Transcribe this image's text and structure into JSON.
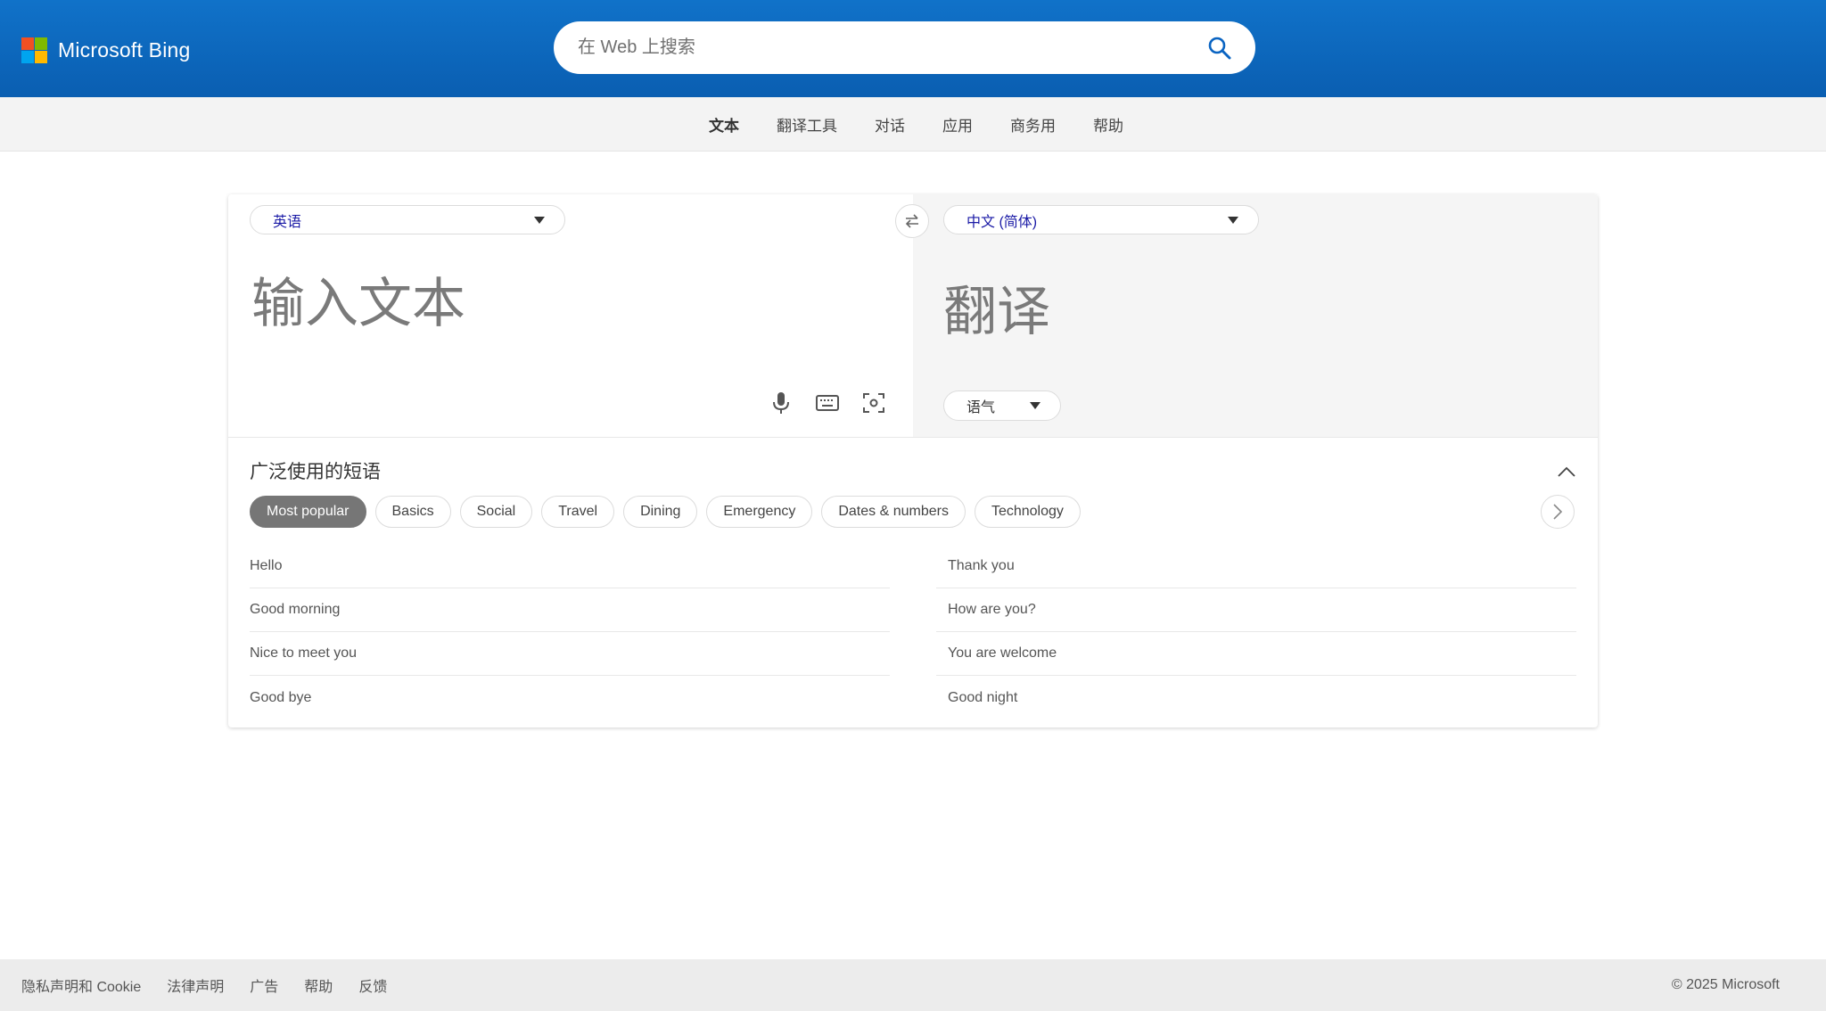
{
  "header": {
    "brand": "Microsoft Bing",
    "logo_colors": [
      "#f25022",
      "#7fba00",
      "#00a4ef",
      "#ffb900"
    ],
    "search_placeholder": "在 Web 上搜索"
  },
  "nav": {
    "items": [
      "文本",
      "翻译工具",
      "对话",
      "应用",
      "商务用",
      "帮助"
    ],
    "active_index": 0
  },
  "translator": {
    "source_lang": "英语",
    "target_lang": "中文 (简体)",
    "source_placeholder": "输入文本",
    "target_placeholder": "翻译",
    "tone_label": "语气"
  },
  "phrases": {
    "title": "广泛使用的短语",
    "categories": [
      "Most popular",
      "Basics",
      "Social",
      "Travel",
      "Dining",
      "Emergency",
      "Dates & numbers",
      "Technology"
    ],
    "active_category": 0,
    "left": [
      "Hello",
      "Good morning",
      "Nice to meet you",
      "Good bye"
    ],
    "right": [
      "Thank you",
      "How are you?",
      "You are welcome",
      "Good night"
    ]
  },
  "footer": {
    "links": [
      "隐私声明和 Cookie",
      "法律声明",
      "广告",
      "帮助",
      "反馈"
    ],
    "copyright": "© 2025 Microsoft"
  },
  "colors": {
    "header_blue": "#0a5eb1",
    "lang_text": "#1a1aa6",
    "active_chip": "#767676"
  }
}
